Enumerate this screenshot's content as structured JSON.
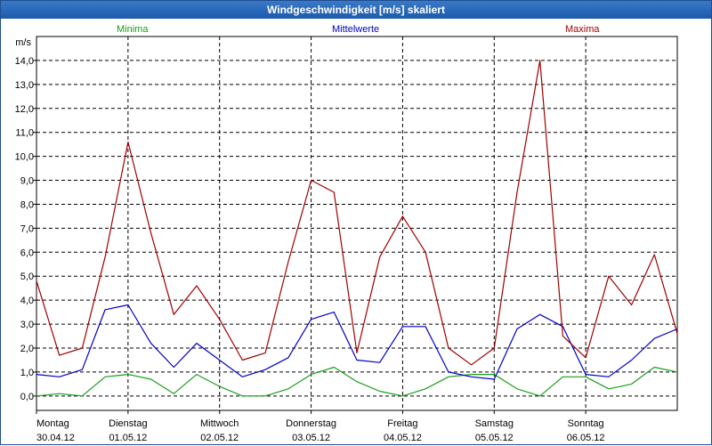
{
  "window": {
    "title": "Windgeschwindigkeit [m/s] skaliert"
  },
  "colors": {
    "min": "#1a9e1a",
    "mean": "#0000c8",
    "max": "#a00000",
    "titlebar": "#2563b4"
  },
  "chart_data": {
    "type": "line",
    "title": "Windgeschwindigkeit [m/s] skaliert",
    "ylabel": "m/s",
    "ylim": [
      -0.6,
      15.0
    ],
    "yticks": [
      "0,0",
      "1,0",
      "2,0",
      "3,0",
      "4,0",
      "5,0",
      "6,0",
      "7,0",
      "8,0",
      "9,0",
      "10,0",
      "11,0",
      "12,0",
      "13,0",
      "14,0"
    ],
    "days": [
      {
        "weekday": "Montag",
        "date": "30.04.12"
      },
      {
        "weekday": "Dienstag",
        "date": "01.05.12"
      },
      {
        "weekday": "Mittwoch",
        "date": "02.05.12"
      },
      {
        "weekday": "Donnerstag",
        "date": "03.05.12"
      },
      {
        "weekday": "Freitag",
        "date": "04.05.12"
      },
      {
        "weekday": "Samstag",
        "date": "05.05.12"
      },
      {
        "weekday": "Sonntag",
        "date": "06.05.12"
      }
    ],
    "x_days": [
      0,
      0.25,
      0.5,
      0.75,
      1.0,
      1.25,
      1.5,
      1.75,
      2.0,
      2.25,
      2.5,
      2.75,
      3.0,
      3.25,
      3.5,
      3.75,
      4.0,
      4.25,
      4.5,
      4.75,
      5.0,
      5.25,
      5.5,
      5.75,
      6.0,
      6.25,
      6.5,
      6.75,
      7.0
    ],
    "grid": true,
    "series": [
      {
        "name": "Minima",
        "values": [
          0.0,
          0.1,
          0.0,
          0.8,
          0.9,
          0.7,
          0.1,
          0.9,
          0.4,
          0.0,
          0.0,
          0.3,
          0.9,
          1.2,
          0.6,
          0.2,
          0.0,
          0.3,
          0.8,
          0.9,
          0.9,
          0.3,
          0.0,
          0.8,
          0.8,
          0.3,
          0.5,
          1.2,
          1.0
        ]
      },
      {
        "name": "Mittelwerte",
        "values": [
          0.9,
          0.8,
          1.1,
          3.6,
          3.8,
          2.2,
          1.2,
          2.2,
          1.5,
          0.8,
          1.1,
          1.6,
          3.2,
          3.5,
          1.5,
          1.4,
          2.9,
          2.9,
          1.0,
          0.8,
          0.7,
          2.8,
          3.4,
          2.9,
          0.9,
          0.8,
          1.5,
          2.4,
          2.8
        ]
      },
      {
        "name": "Maxima",
        "values": [
          4.8,
          1.7,
          2.0,
          5.8,
          10.6,
          6.8,
          3.4,
          4.6,
          3.2,
          1.5,
          1.8,
          5.6,
          9.0,
          8.5,
          1.8,
          5.8,
          7.5,
          6.0,
          2.0,
          1.3,
          2.0,
          8.5,
          14.0,
          2.5,
          1.6,
          5.0,
          3.8,
          5.9,
          2.6
        ]
      }
    ]
  }
}
